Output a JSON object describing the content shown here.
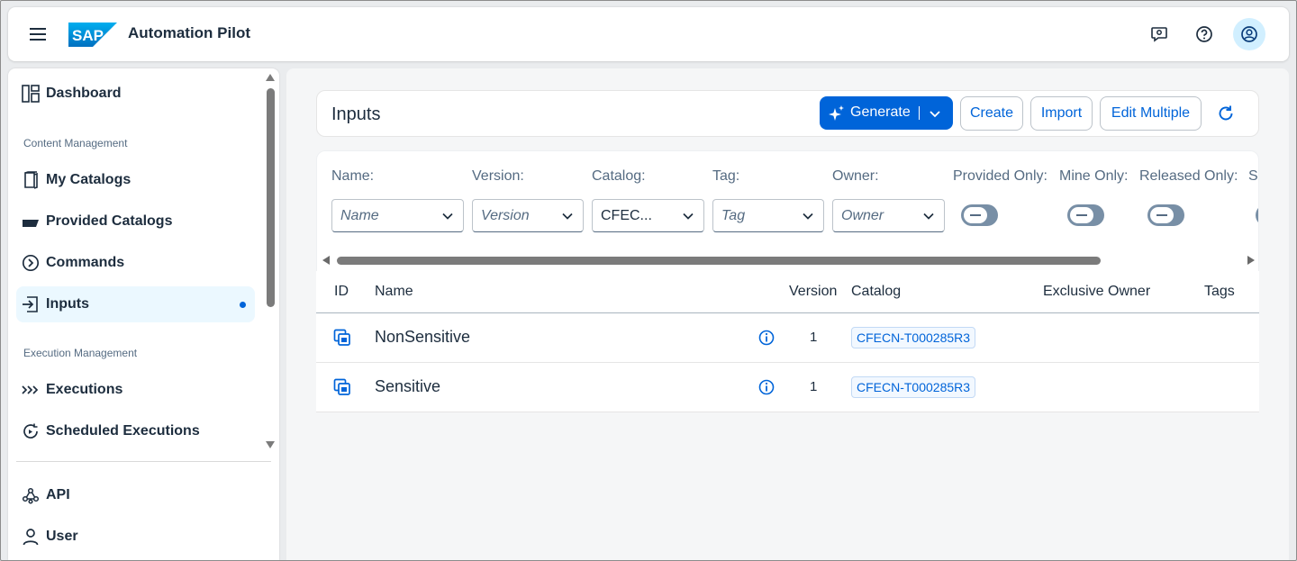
{
  "shell": {
    "app_title": "Automation Pilot",
    "logo_text": "SAP"
  },
  "sidenav": {
    "dashboard": "Dashboard",
    "group_content": "Content Management",
    "my_catalogs": "My Catalogs",
    "provided_catalogs": "Provided Catalogs",
    "commands": "Commands",
    "inputs": "Inputs",
    "group_execution": "Execution Management",
    "executions": "Executions",
    "scheduled_executions": "Scheduled Executions",
    "api": "API",
    "user": "User"
  },
  "header": {
    "title": "Inputs",
    "generate_label": "Generate",
    "create_label": "Create",
    "import_label": "Import",
    "edit_multiple_label": "Edit Multiple"
  },
  "filters": {
    "name_label": "Name:",
    "name_placeholder": "Name",
    "version_label": "Version:",
    "version_placeholder": "Version",
    "catalog_label": "Catalog:",
    "catalog_value": "CFEC...",
    "tag_label": "Tag:",
    "tag_placeholder": "Tag",
    "owner_label": "Owner:",
    "owner_placeholder": "Owner",
    "provided_only_label": "Provided Only:",
    "mine_only_label": "Mine Only:",
    "released_only_label": "Released Only:",
    "truncated_label": "S"
  },
  "table": {
    "columns": {
      "id": "ID",
      "name": "Name",
      "version": "Version",
      "catalog": "Catalog",
      "exclusive_owner": "Exclusive Owner",
      "tags": "Tags"
    },
    "rows": [
      {
        "name": "NonSensitive",
        "version": "1",
        "catalog": "CFECN-T000285R3"
      },
      {
        "name": "Sensitive",
        "version": "1",
        "catalog": "CFECN-T000285R3"
      }
    ]
  },
  "colors": {
    "brand": "#0064d9",
    "text": "#1d2d3e",
    "selected_nav": "#ebf8ff"
  }
}
